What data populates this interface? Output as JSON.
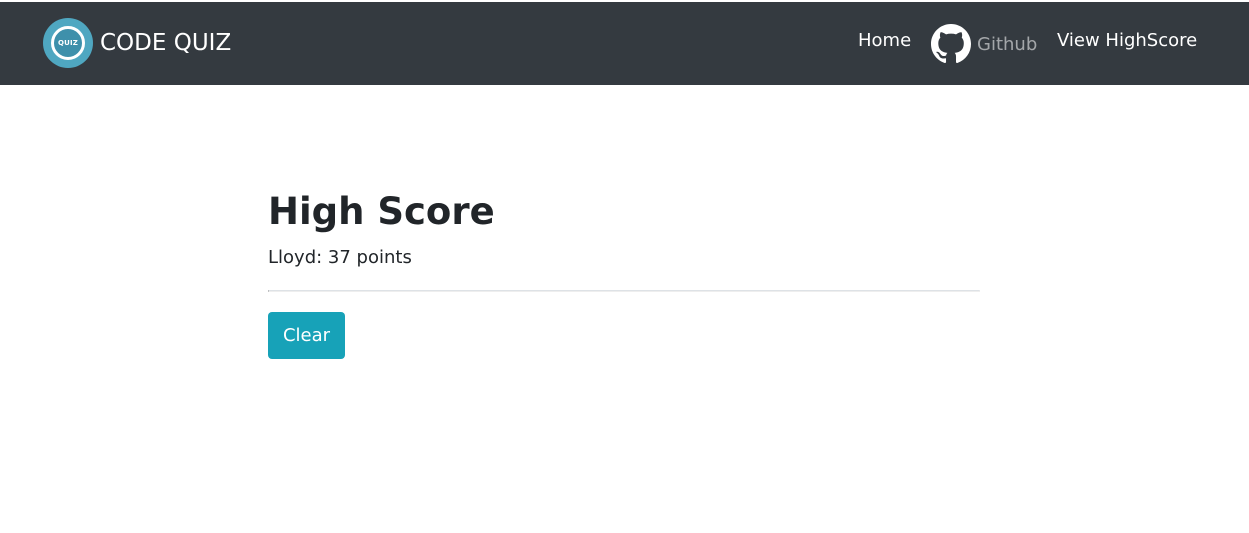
{
  "navbar": {
    "brand": {
      "logo_icon": "quiz-logo-icon",
      "logo_text": "QUIZ",
      "title": "CODE QUIZ"
    },
    "links": {
      "home": "Home",
      "github": "Github",
      "github_icon": "github-icon",
      "highscore": "View HighScore"
    },
    "background_color": "#343a40",
    "link_color": "#ffffff",
    "muted_link_color": "rgba(255,255,255,0.55)"
  },
  "main": {
    "title": "High Score",
    "scores": [
      "Lloyd: 37 points"
    ],
    "clear_label": "Clear",
    "button_color": "#17a2b8"
  }
}
